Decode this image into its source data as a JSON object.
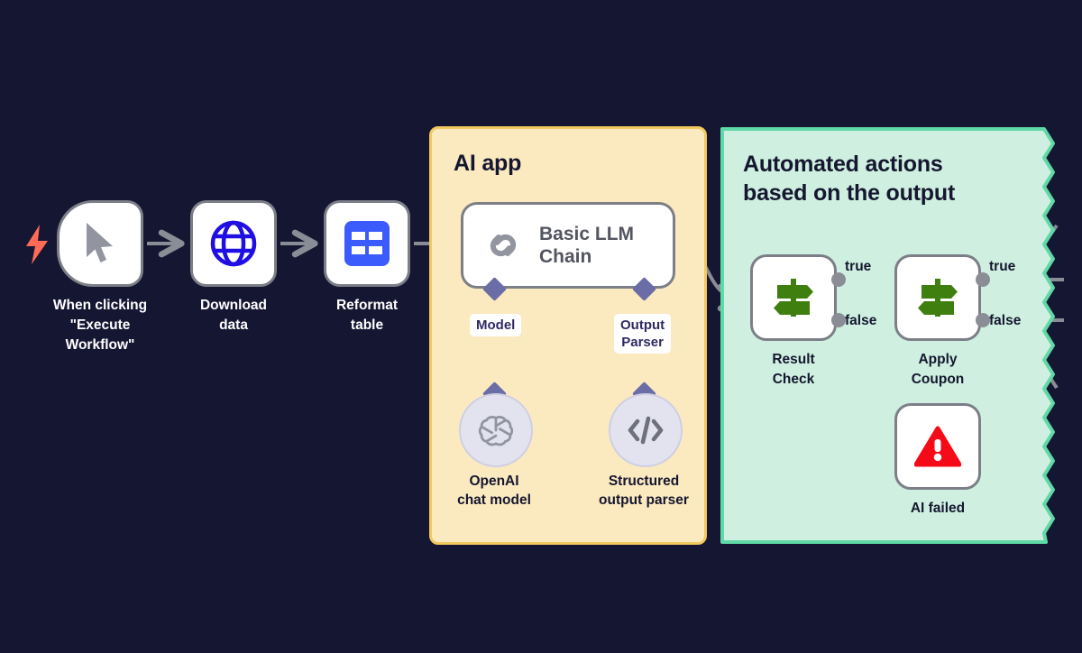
{
  "meta": {
    "background_color": "#151632",
    "node_border_color": "#7c7f87",
    "wire_color": "#8A8D95"
  },
  "trigger": {
    "icon": "lightning-bolt-icon",
    "color": "#FF6B57"
  },
  "nodes": [
    {
      "id": "when-clicking-execute-workflow",
      "label": "When clicking\n\"Execute\nWorkflow\"",
      "label_line1": "When clicking",
      "label_line2": "\"Execute",
      "label_line3": "Workflow\"",
      "icon": "mouse-cursor-icon",
      "icon_color": "#9295A0"
    },
    {
      "id": "download-data",
      "label_line1": "Download",
      "label_line2": "data",
      "icon": "globe-icon",
      "icon_color": "#1F0FE3"
    },
    {
      "id": "reformat-table",
      "label_line1": "Reformat",
      "label_line2": "table",
      "icon": "table-icon",
      "icon_color": "#3B5BFD"
    }
  ],
  "ai_panel": {
    "title": "AI app",
    "background_color": "#FBEAC0",
    "border_color": "#F3C95F",
    "main_node": {
      "id": "basic-llm-chain",
      "title_line1": "Basic LLM",
      "title_line2": "Chain",
      "icon": "chain-link-icon",
      "icon_color": "#9295A0"
    },
    "ports": [
      {
        "id": "model-port",
        "badge": "Model",
        "badge_line1": "Model",
        "badge_line2": ""
      },
      {
        "id": "output-parser-port",
        "badge": "Output Parser",
        "badge_line1": "Output",
        "badge_line2": "Parser"
      }
    ],
    "subnodes": [
      {
        "id": "openai-chat-model",
        "icon": "openai-icon",
        "label_line1": "OpenAI",
        "label_line2": "chat model"
      },
      {
        "id": "structured-output-parser",
        "icon": "code-brackets-icon",
        "label_line1": "Structured",
        "label_line2": "output parser"
      }
    ]
  },
  "automation_panel": {
    "title_line1": "Automated actions",
    "title_line2": "based on the output",
    "background_color": "#CFF0E0",
    "border_color": "#5FD9A6",
    "nodes": [
      {
        "id": "result-check",
        "label_line1": "Result",
        "label_line2": "Check",
        "icon": "signpost-icon",
        "icon_color": "#3F7F10",
        "outputs": [
          {
            "id": "result-check-true",
            "label": "true"
          },
          {
            "id": "result-check-false",
            "label": "false"
          }
        ]
      },
      {
        "id": "apply-coupon",
        "label_line1": "Apply",
        "label_line2": "Coupon",
        "icon": "signpost-icon",
        "icon_color": "#3F7F10",
        "outputs": [
          {
            "id": "apply-coupon-true",
            "label": "true"
          },
          {
            "id": "apply-coupon-false",
            "label": "false"
          }
        ]
      },
      {
        "id": "ai-failed",
        "label_line1": "AI failed",
        "label_line2": "",
        "icon": "warning-triangle-icon",
        "icon_color": "#F50B17"
      }
    ]
  }
}
